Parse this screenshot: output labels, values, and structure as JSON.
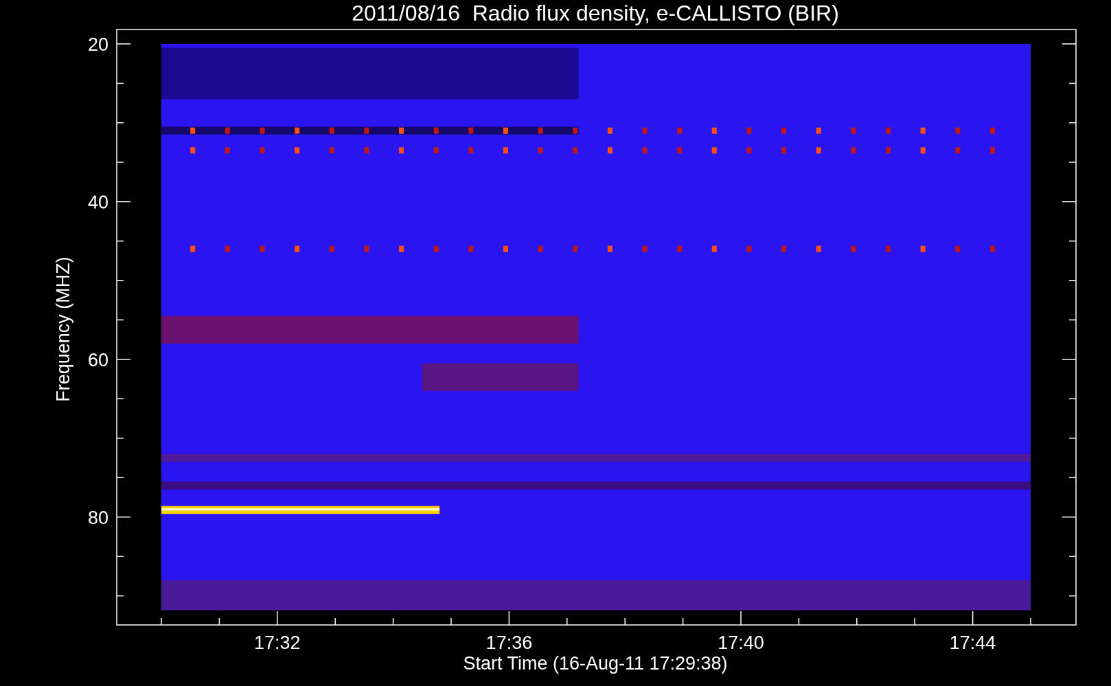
{
  "title": "2011/08/16  Radio flux density, e-CALLISTO (BIR)",
  "y_axis": {
    "label": "Frequency (MHZ)",
    "ticks": [
      "20",
      "40",
      "60",
      "80"
    ]
  },
  "x_axis": {
    "label": "Start Time (16-Aug-11 17:29:38)",
    "ticks": [
      "17:32",
      "17:36",
      "17:40",
      "17:44"
    ]
  }
}
